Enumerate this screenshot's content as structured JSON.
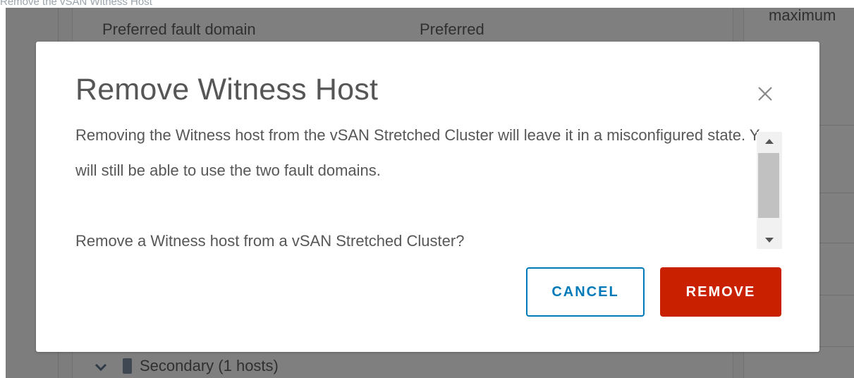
{
  "caption": "Remove the vSAN Witness Host",
  "background": {
    "row_label": "Preferred fault domain",
    "row_value": "Preferred",
    "right_panel_text": "maximum",
    "secondary_label": "Secondary (1 hosts)"
  },
  "modal": {
    "title": "Remove Witness Host",
    "paragraphs": [
      "Removing the Witness host from the vSAN Stretched Cluster will leave it in a misconfigured state. You will still be able to use the two fault domains.",
      "Remove a Witness host from a vSAN Stretched Cluster?"
    ],
    "cancel_label": "CANCEL",
    "remove_label": "REMOVE"
  },
  "colors": {
    "overlay": "#7d7d7d",
    "primary_blue": "#0079b8",
    "danger_red": "#c92100",
    "text": "#575757"
  },
  "icons": {
    "close": "close-icon",
    "chevron": "chevron-down-icon",
    "host": "host-icon",
    "scroll_up": "arrow-up-icon",
    "scroll_down": "arrow-down-icon"
  }
}
